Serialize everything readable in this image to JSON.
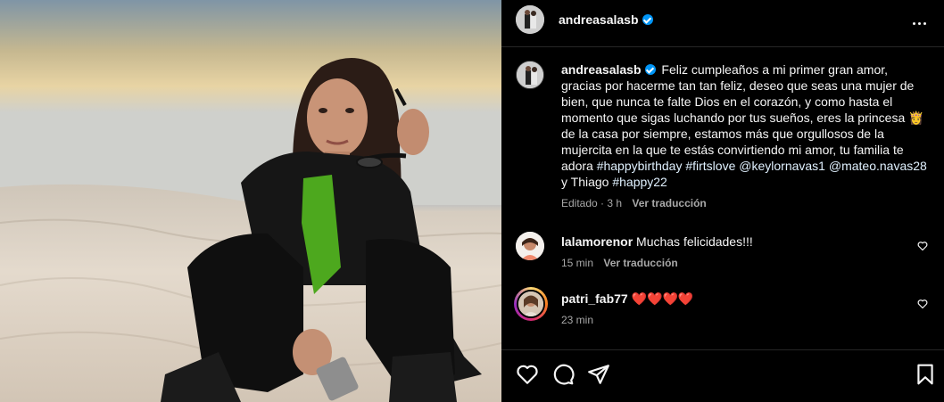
{
  "post": {
    "username": "andreasalasb",
    "verified": true,
    "caption_prefix": "Feliz cumpleaños a mi primer gran amor, gracias por hacerme tan tan feliz, deseo que seas una mujer de bien, que nunca te falte Dios en el corazón, y como hasta el momento que sigas luchando por tus sueños, eres la princesa 👸 de la casa por siempre, estamos más que orgullosos de la mujercita en la que te estás convirtiendo mi amor, tu familia te adora",
    "tag_1": "#happybirthday",
    "tag_2": "#firtslove",
    "mention_1": "@keylornavas1",
    "mention_2": "@mateo.navas28",
    "caption_mid": "y Thiago",
    "tag_3": "#happy22",
    "edited_label": "Editado · 3 h",
    "translate_label": "Ver traducción"
  },
  "comments": [
    {
      "username": "lalamorenor",
      "text": "Muchas felicidades!!!",
      "time": "15 min",
      "translate_label": "Ver traducción"
    },
    {
      "username": "patri_fab77",
      "text": "❤️❤️❤️❤️",
      "time": "23 min"
    }
  ],
  "icons": {
    "more": "more-options-icon",
    "like": "heart-icon",
    "comment": "comment-icon",
    "share": "paper-plane-icon",
    "save": "bookmark-icon"
  },
  "colors": {
    "background": "#000000",
    "verified": "#0095f6",
    "secondary_text": "#a8a8a8",
    "link": "#e0f1ff"
  }
}
